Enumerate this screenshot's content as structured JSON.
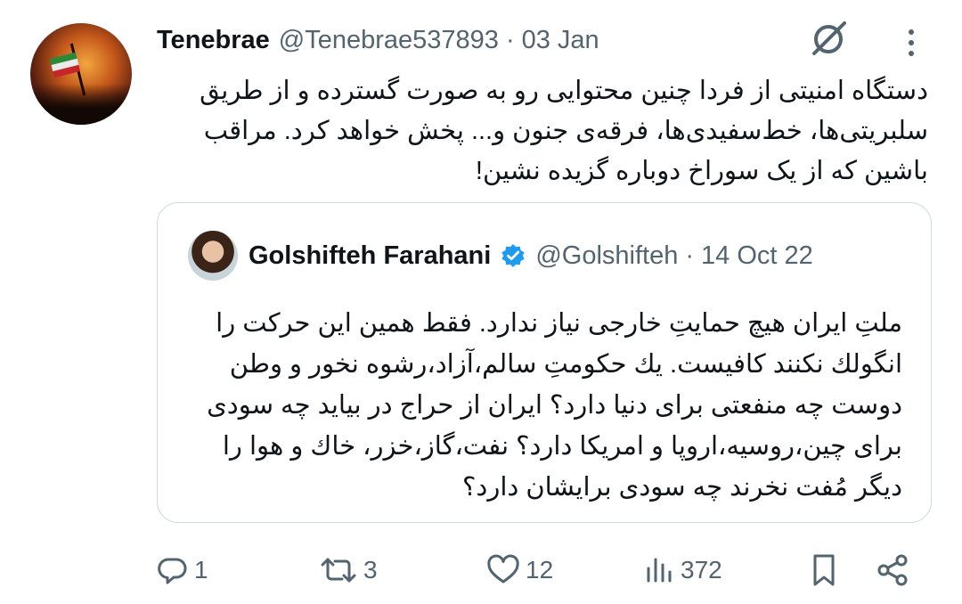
{
  "tweet": {
    "display_name": "Tenebrae",
    "handle": "@Tenebrae537893",
    "separator": "·",
    "date": "03 Jan",
    "text": "دستگاه امنیتی از فردا چنین محتوایی رو به صورت گسترده و از طریق سلبریتی‌ها، خط‌سفیدی‌ها، فرقه‌ی جنون و... پخش خواهد کرد. مراقب باشین که از یک سوراخ دوباره گزیده نشین!"
  },
  "quoted_tweet": {
    "display_name": "Golshifteh Farahani",
    "handle": "@Golshifteh",
    "separator": "·",
    "date": "14 Oct 22",
    "text": "ملتِ ایران هیچ حمایتِ خارجی نیاز ندارد. فقط همین این حرکت را انگولك نکنند کافیست. یك حکومتِ سالم،آزاد،رشوه نخور و وطن دوست چه  منفعتی برای دنیا دارد؟ ایران از حراج در بیاید چه سودی برای چین،روسیه،اروپا و امریکا دارد؟ نفت،گاز،خزر، خاك و هوا را دیگر مُفت نخرند چه سودی برایشان دارد؟"
  },
  "actions": {
    "replies": "1",
    "retweets": "3",
    "likes": "12",
    "views": "372"
  },
  "colors": {
    "text": "#0f1419",
    "secondary": "#536471",
    "border": "#cfd9de",
    "verified": "#1d9bf0"
  },
  "icons": [
    "grok-icon",
    "more-icon",
    "verified-badge-icon",
    "reply-icon",
    "retweet-icon",
    "like-icon",
    "views-icon",
    "bookmark-icon",
    "share-icon"
  ]
}
